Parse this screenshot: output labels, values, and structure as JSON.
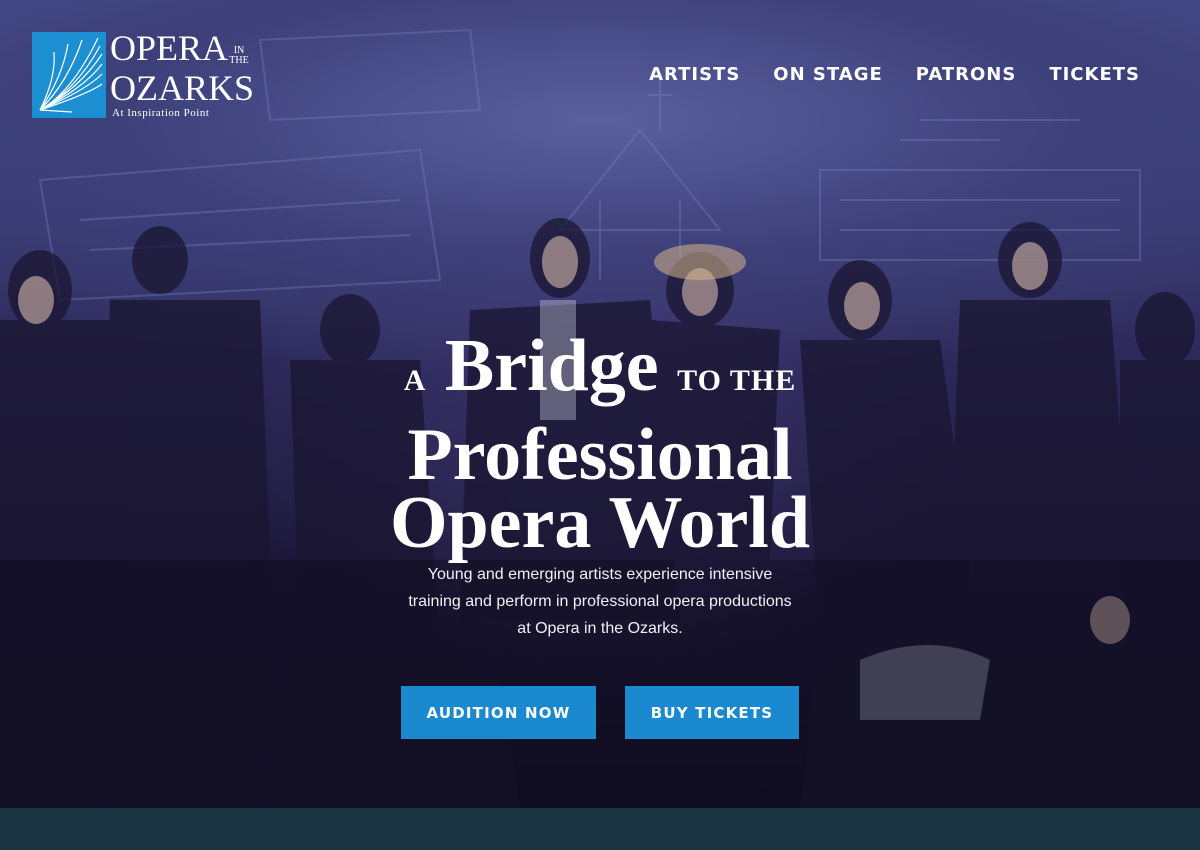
{
  "logo": {
    "opera": "OPERA",
    "in_the": "IN THE",
    "ozarks": "OZARKS",
    "subtitle": "At Inspiration Point"
  },
  "nav": {
    "items": [
      "ARTISTS",
      "ON STAGE",
      "PATRONS",
      "TICKETS"
    ]
  },
  "hero": {
    "headline_a": "A",
    "headline_bridge": "Bridge",
    "headline_tothe": "TO THE",
    "headline_professional": "Professional",
    "headline_operaworld": "Opera World",
    "description": "Young and emerging artists experience intensive training and perform in professional opera productions at Opera in the Ozarks.",
    "background_image": "opera-cast-performance-photo"
  },
  "buttons": {
    "audition": "AUDITION NOW",
    "tickets": "BUY TICKETS"
  },
  "colors": {
    "accent": "#1a89d0",
    "logo_blue": "#1b8fd2",
    "footer_band": "#193341"
  }
}
